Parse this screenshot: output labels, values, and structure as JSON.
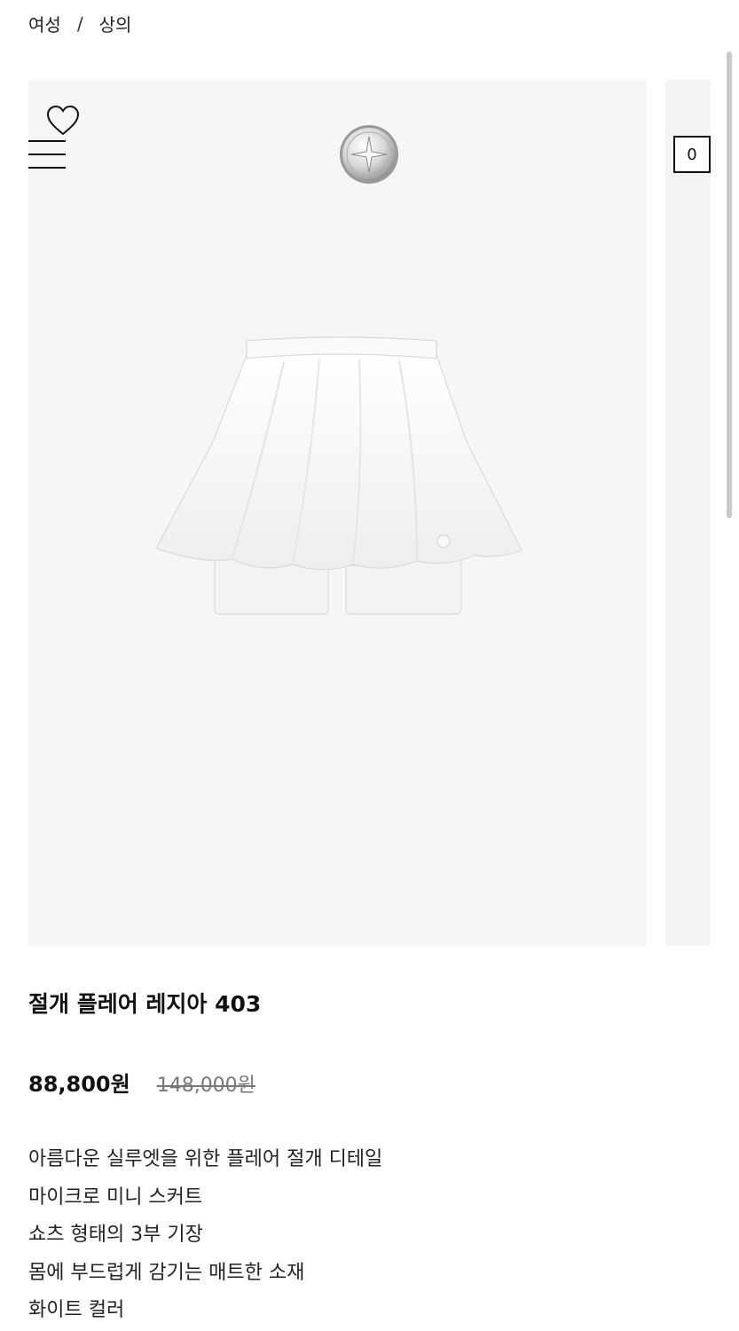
{
  "breadcrumb": {
    "items": [
      "여성",
      "상의"
    ],
    "separator": "/"
  },
  "header": {
    "cart_count": "0",
    "icons": [
      "heart-icon",
      "hamburger-menu-icon",
      "brand-logo-icon"
    ]
  },
  "product": {
    "name": "절개 플레어 레지아 403",
    "sale_price": "88,800원",
    "original_price": "148,000원",
    "description": [
      "아름다운 실루엣을 위한 플레어 절개 디테일",
      "마이크로 미니 스커트",
      "쇼츠 형태의 3부 기장",
      "몸에 부드럽게 감기는 매트한 소재",
      "화이트 컬러"
    ],
    "image_alt": "white flared skort"
  },
  "colors": {
    "text": "#111111",
    "gallery_bg": "#f6f6f6",
    "strike_price": "#777777"
  }
}
